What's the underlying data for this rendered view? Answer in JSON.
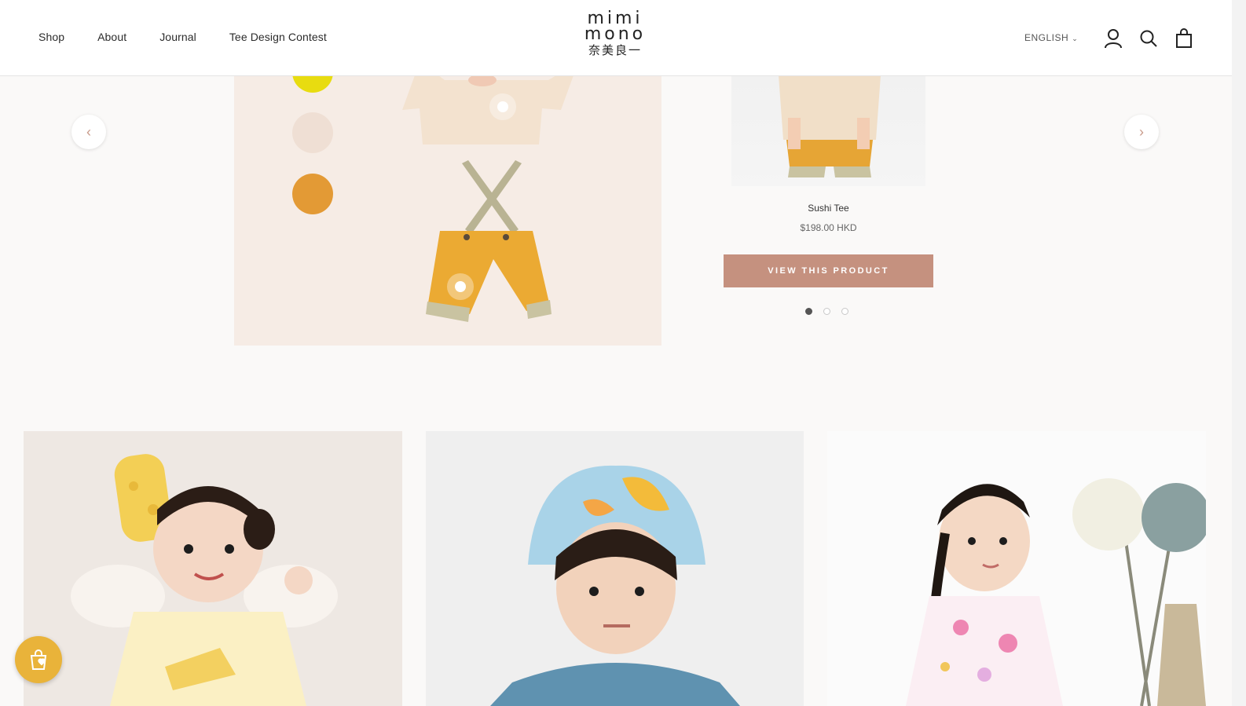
{
  "header": {
    "nav": [
      {
        "label": "Shop"
      },
      {
        "label": "About"
      },
      {
        "label": "Journal"
      },
      {
        "label": "Tee Design Contest"
      }
    ],
    "logo": {
      "line1": "mimi",
      "line2": "mono",
      "cjk": "奈美良一"
    },
    "language": "ENGLISH",
    "icons": [
      "account-icon",
      "search-icon",
      "cart-icon"
    ]
  },
  "carousel": {
    "prev_icon": "chevron-left-icon",
    "next_icon": "chevron-right-icon",
    "swatch_colors": [
      "#e8dc10",
      "#efdfd4",
      "#e39a35"
    ],
    "product": {
      "title": "Sushi Tee",
      "price": "$198.00 HKD",
      "cta": "VIEW THIS PRODUCT"
    },
    "pagination": {
      "count": 3,
      "active": 1
    }
  },
  "collections": [
    {
      "name": "toddler-cheese-tee"
    },
    {
      "name": "boy-bucket-hat"
    },
    {
      "name": "girl-floral-dress"
    }
  ],
  "floating_badge": {
    "icon": "shopping-bag-heart-icon",
    "color": "#e9b33a"
  },
  "colors": {
    "accent": "#c5917f",
    "text": "#2b2b2b",
    "background": "#faf9f8"
  }
}
